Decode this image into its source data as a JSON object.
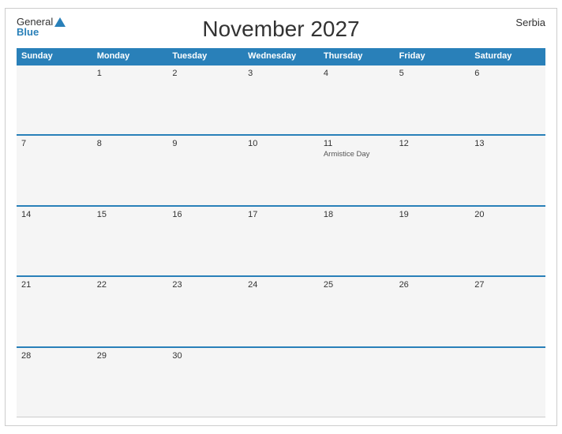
{
  "calendar": {
    "title": "November 2027",
    "country": "Serbia",
    "weekdays": [
      "Sunday",
      "Monday",
      "Tuesday",
      "Wednesday",
      "Thursday",
      "Friday",
      "Saturday"
    ],
    "weeks": [
      [
        {
          "day": "",
          "events": []
        },
        {
          "day": "1",
          "events": []
        },
        {
          "day": "2",
          "events": []
        },
        {
          "day": "3",
          "events": []
        },
        {
          "day": "4",
          "events": []
        },
        {
          "day": "5",
          "events": []
        },
        {
          "day": "6",
          "events": []
        }
      ],
      [
        {
          "day": "7",
          "events": []
        },
        {
          "day": "8",
          "events": []
        },
        {
          "day": "9",
          "events": []
        },
        {
          "day": "10",
          "events": []
        },
        {
          "day": "11",
          "events": [
            "Armistice Day"
          ]
        },
        {
          "day": "12",
          "events": []
        },
        {
          "day": "13",
          "events": []
        }
      ],
      [
        {
          "day": "14",
          "events": []
        },
        {
          "day": "15",
          "events": []
        },
        {
          "day": "16",
          "events": []
        },
        {
          "day": "17",
          "events": []
        },
        {
          "day": "18",
          "events": []
        },
        {
          "day": "19",
          "events": []
        },
        {
          "day": "20",
          "events": []
        }
      ],
      [
        {
          "day": "21",
          "events": []
        },
        {
          "day": "22",
          "events": []
        },
        {
          "day": "23",
          "events": []
        },
        {
          "day": "24",
          "events": []
        },
        {
          "day": "25",
          "events": []
        },
        {
          "day": "26",
          "events": []
        },
        {
          "day": "27",
          "events": []
        }
      ],
      [
        {
          "day": "28",
          "events": []
        },
        {
          "day": "29",
          "events": []
        },
        {
          "day": "30",
          "events": []
        },
        {
          "day": "",
          "events": []
        },
        {
          "day": "",
          "events": []
        },
        {
          "day": "",
          "events": []
        },
        {
          "day": "",
          "events": []
        }
      ]
    ],
    "logo": {
      "general": "General",
      "blue": "Blue"
    }
  }
}
